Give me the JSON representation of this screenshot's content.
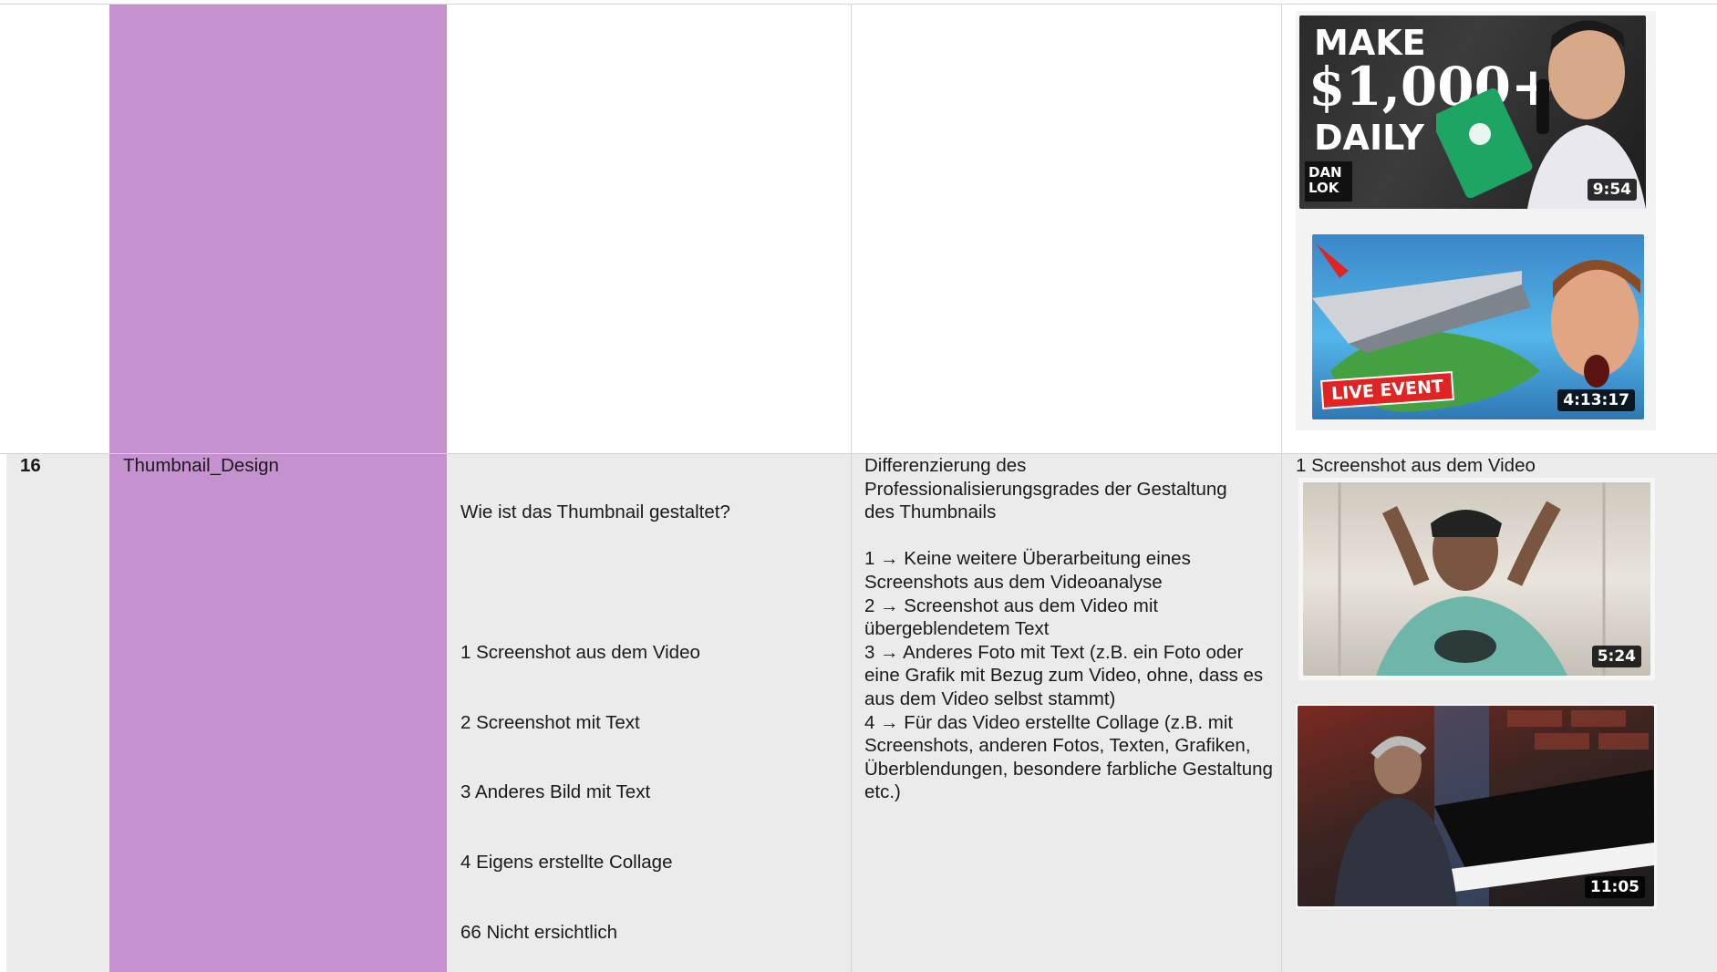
{
  "row_top": {
    "thumbnails": [
      {
        "duration": "9:54",
        "headline_1": "MAKE",
        "headline_2": "$1,000+",
        "headline_3": "DAILY",
        "logo": "DAN LOK"
      },
      {
        "duration": "4:13:17",
        "tag": "LIVE EVENT"
      }
    ]
  },
  "row_16": {
    "number": "16",
    "variable": "Thumbnail_Design",
    "question": "Wie ist das Thumbnail gestaltet?",
    "codes": [
      "1 Screenshot aus dem Video",
      "2 Screenshot mit Text",
      "3 Anderes Bild mit Text",
      "4 Eigens erstellte Collage",
      "66 Nicht ersichtlich"
    ],
    "description_intro": "Differenzierung des Professionalisierungsgrades der Gestaltung des Thumbnails",
    "description_items": [
      "1 → Keine weitere Überarbeitung eines Screenshots aus dem Videoanalyse",
      "2 → Screenshot aus dem Video mit übergeblendetem Text",
      "3 → Anderes Foto mit Text (z.B. ein Foto oder eine Grafik mit Bezug zum Video, ohne, dass es aus dem Video selbst stammt)",
      "4 → Für das Video erstellte Collage (z.B. mit Screenshots, anderen Fotos, Texten, Grafiken, Überblendungen, besondere farbliche Gestaltung etc.)"
    ],
    "example_label": "1 Screenshot aus dem Video",
    "thumbnails": [
      {
        "duration": "5:24"
      },
      {
        "duration": "11:05"
      }
    ]
  },
  "colors": {
    "purple": "#c592cf",
    "row_gray": "#ebebeb",
    "grid": "#d4d4d4"
  }
}
